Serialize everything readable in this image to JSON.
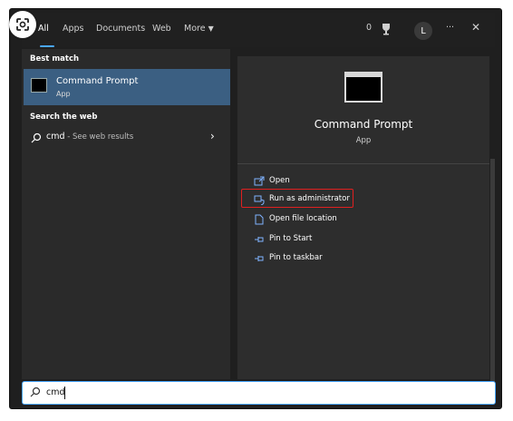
{
  "tabs": [
    {
      "label": "All",
      "active": true
    },
    {
      "label": "Apps"
    },
    {
      "label": "Documents"
    },
    {
      "label": "Web"
    },
    {
      "label": "More"
    }
  ],
  "topbar_right": {
    "points": "0",
    "avatar_letter": "L",
    "more_glyph": "···",
    "close_glyph": "✕"
  },
  "left_panel": {
    "best_match_label": "Best match",
    "best_match": {
      "title": "Command Prompt",
      "subtitle": "App"
    },
    "search_web_label": "Search the web",
    "web_result": {
      "query": "cmd",
      "suffix": " - See web results"
    }
  },
  "right_panel": {
    "title": "Command Prompt",
    "subtitle": "App",
    "actions": [
      {
        "label": "Open",
        "icon": "open-icon"
      },
      {
        "label": "Run as administrator",
        "icon": "shield-icon",
        "highlighted": true
      },
      {
        "label": "Open file location",
        "icon": "folder-icon"
      },
      {
        "label": "Pin to Start",
        "icon": "pin-icon"
      },
      {
        "label": "Pin to taskbar",
        "icon": "pin-icon"
      }
    ]
  },
  "search": {
    "value": "cmd"
  },
  "colors": {
    "accent": "#4aa8ff",
    "highlight_border": "#e02020",
    "selected_row": "#3b5f82"
  }
}
